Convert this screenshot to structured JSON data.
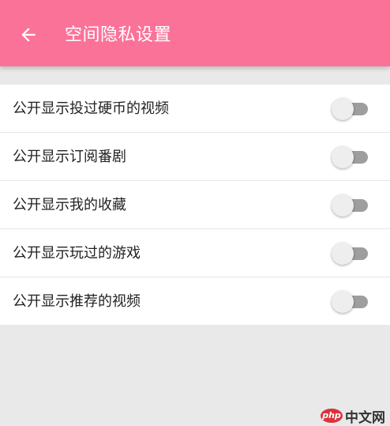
{
  "header": {
    "title": "空间隐私设置",
    "back_icon": "arrow-left-icon",
    "background_color": "#fb7299"
  },
  "settings": [
    {
      "label": "公开显示投过硬币的视频",
      "enabled": false
    },
    {
      "label": "公开显示订阅番剧",
      "enabled": false
    },
    {
      "label": "公开显示我的收藏",
      "enabled": false
    },
    {
      "label": "公开显示玩过的游戏",
      "enabled": false
    },
    {
      "label": "公开显示推荐的视频",
      "enabled": false
    }
  ],
  "watermark": {
    "badge": "php",
    "text": "中文网"
  }
}
